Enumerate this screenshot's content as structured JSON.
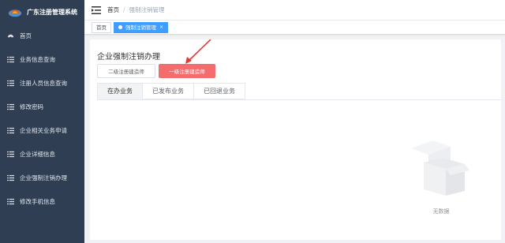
{
  "app": {
    "title": "广东注册管理系统"
  },
  "sidebar": {
    "items": [
      {
        "label": "首页",
        "icon": "dashboard-icon"
      },
      {
        "label": "业务信息查询",
        "icon": "list-icon"
      },
      {
        "label": "注册人员信息查询",
        "icon": "list-icon"
      },
      {
        "label": "修改密码",
        "icon": "list-icon"
      },
      {
        "label": "企业相关业务申请",
        "icon": "list-icon"
      },
      {
        "label": "企业详细信息",
        "icon": "list-icon"
      },
      {
        "label": "企业强制注销办理",
        "icon": "list-icon"
      },
      {
        "label": "修改手机信息",
        "icon": "list-icon"
      }
    ]
  },
  "breadcrumb": {
    "home": "首页",
    "separator": "/",
    "current": "强制注销管理"
  },
  "tags": {
    "home": "首页",
    "active": "强制注销管理",
    "close": "×"
  },
  "main": {
    "title": "企业强制注销办理",
    "btn_secondary": "二级注册建造师",
    "btn_primary": "一级注册建造师",
    "tabs": [
      {
        "label": "在办业务"
      },
      {
        "label": "已发布业务"
      },
      {
        "label": "已回退业务"
      }
    ],
    "empty_text": "无数据"
  },
  "colors": {
    "sidebar_bg": "#2f3e52",
    "primary_button": "#f56c6c",
    "active_tag": "#409eff",
    "arrow": "#e53935"
  }
}
